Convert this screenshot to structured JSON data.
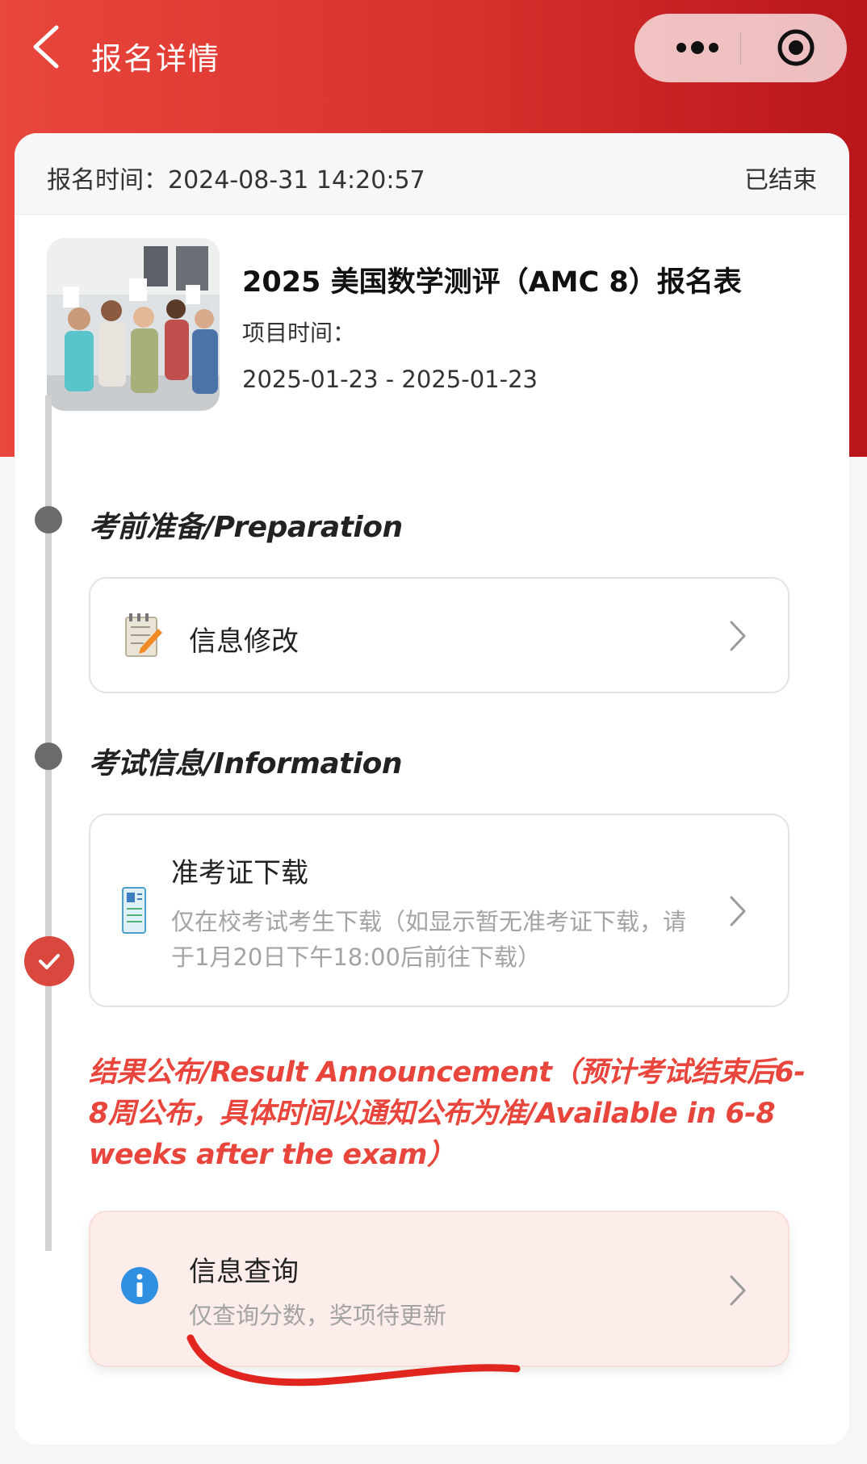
{
  "nav": {
    "title": "报名详情"
  },
  "header": {
    "registration_time": "报名时间：2024-08-31 14:20:57",
    "status": "已结束"
  },
  "project": {
    "title": "2025 美国数学测评（AMC 8）报名表",
    "time_label": "项目时间：",
    "time_range": "2025-01-23 - 2025-01-23"
  },
  "steps": [
    {
      "title": "考前准备/Preparation",
      "item": {
        "label": "信息修改",
        "icon": "edit-notepad-icon"
      }
    },
    {
      "title": "考试信息/Information",
      "item": {
        "label": "准考证下载",
        "sub": "仅在校考试考生下载（如显示暂无准考证下载，请于1月20日下午18:00后前往下载）",
        "icon": "admission-ticket-icon"
      }
    },
    {
      "title": "结果公布/Result Announcement（预计考试结束后6-8周公布，具体时间以通知公布为准/Available in 6-8 weeks after the exam）",
      "item": {
        "label": "信息查询",
        "sub": "仅查询分数，奖项待更新",
        "icon": "info-icon"
      }
    }
  ],
  "colors": {
    "brand_red": "#d8302c",
    "accent_red": "#e8453c",
    "info_blue": "#2f8fe0",
    "annotation_red": "#e0261f"
  }
}
